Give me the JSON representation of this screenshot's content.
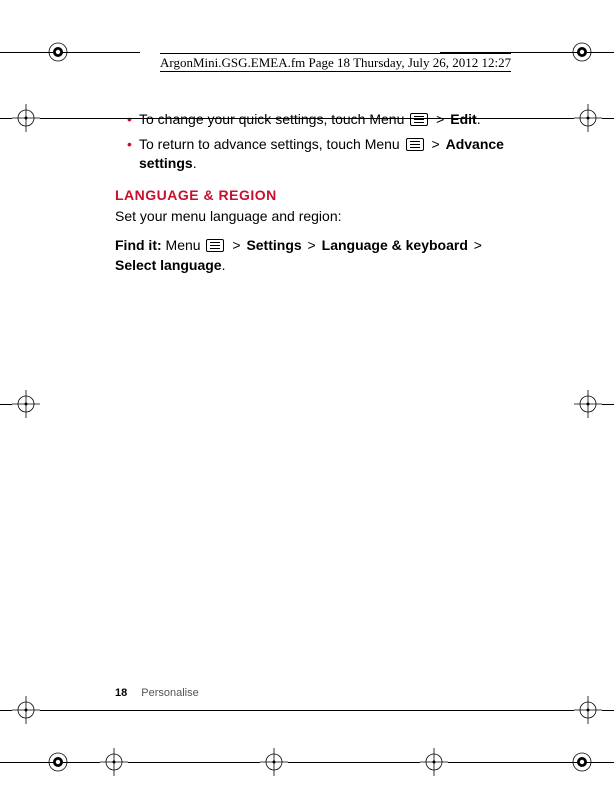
{
  "header": {
    "runner": "ArgonMini.GSG.EMEA.fm  Page 18  Thursday, July 26, 2012  12:27"
  },
  "bullets": {
    "b1_before": "To change your quick settings, touch Menu ",
    "b1_after": " > ",
    "b1_bold": "Edit",
    "b1_period": ".",
    "b2_before": "To return to advance settings, touch Menu ",
    "b2_after": " > ",
    "b2_bold": "Advance settings",
    "b2_period": "."
  },
  "section": {
    "head": "LANGUAGE & REGION",
    "intro": "Set your menu language and region:",
    "findit_label": "Find it:",
    "findit_menu": " Menu ",
    "gt": " > ",
    "settings": "Settings",
    "langkb": "Language & keyboard",
    "selectlang": "Select language",
    "period": "."
  },
  "footer": {
    "page": "18",
    "section": "Personalise"
  }
}
